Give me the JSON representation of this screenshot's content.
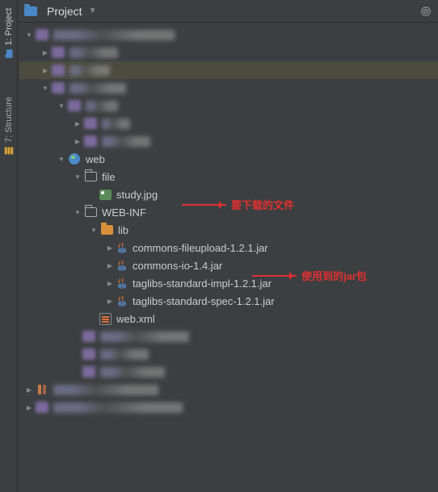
{
  "sideTabs": {
    "project": "1: Project",
    "structure": "7: Structure"
  },
  "toolbar": {
    "title": "Project"
  },
  "tree": {
    "web": "web",
    "file": "file",
    "study_jpg": "study.jpg",
    "web_inf": "WEB-INF",
    "lib": "lib",
    "jar1": "commons-fileupload-1.2.1.jar",
    "jar2": "commons-io-1.4.jar",
    "jar3": "taglibs-standard-impl-1.2.1.jar",
    "jar4": "taglibs-standard-spec-1.2.1.jar",
    "web_xml": "web.xml"
  },
  "annotations": {
    "download_file": "要下载的文件",
    "used_jars": "使用到的jar包"
  }
}
